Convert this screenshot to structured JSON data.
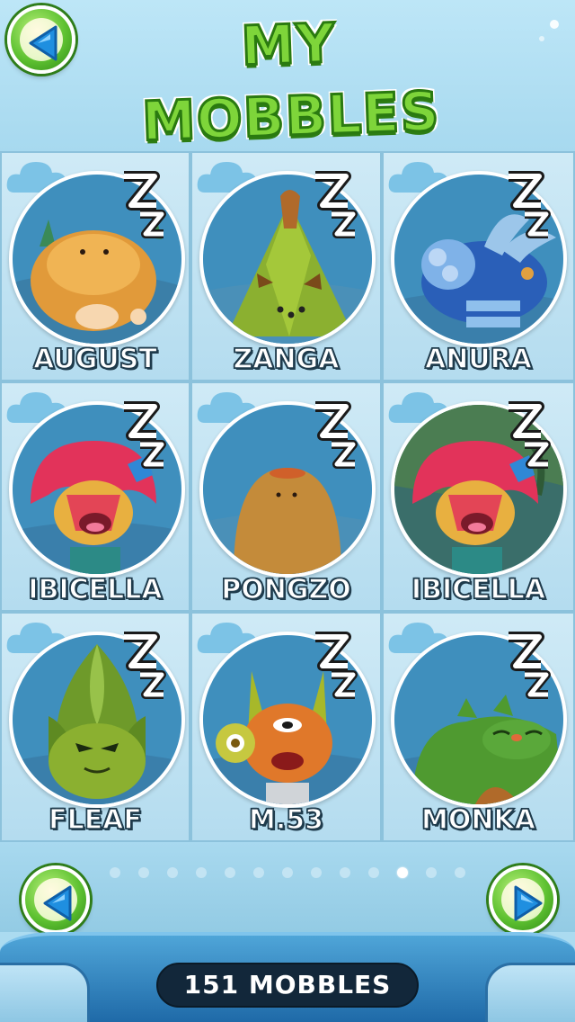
{
  "header": {
    "title": "MY MOBBLES",
    "back_icon": "left-triangle-arrow"
  },
  "mobbles": [
    {
      "name": "AUGUST",
      "status": "sleeping"
    },
    {
      "name": "ZANGA",
      "status": "sleeping"
    },
    {
      "name": "ANURA",
      "status": "sleeping"
    },
    {
      "name": "IBICELLA",
      "status": "sleeping"
    },
    {
      "name": "PONGZO",
      "status": "sleeping"
    },
    {
      "name": "IBICELLA",
      "status": "sleeping"
    },
    {
      "name": "FLEAF",
      "status": "sleeping"
    },
    {
      "name": "M.53",
      "status": "sleeping"
    },
    {
      "name": "MONKA",
      "status": "sleeping"
    }
  ],
  "pager": {
    "page_count": 13,
    "active_page": 11,
    "prev_icon": "left-triangle-arrow",
    "next_icon": "right-triangle-arrow"
  },
  "footer": {
    "count_label": "151 MOBBLES"
  },
  "colors": {
    "accent_green": "#7ed53a",
    "button_arrow_blue": "#1f8fe0",
    "footer_blue": "#1f6aa8",
    "pill_dark": "#12273a"
  }
}
